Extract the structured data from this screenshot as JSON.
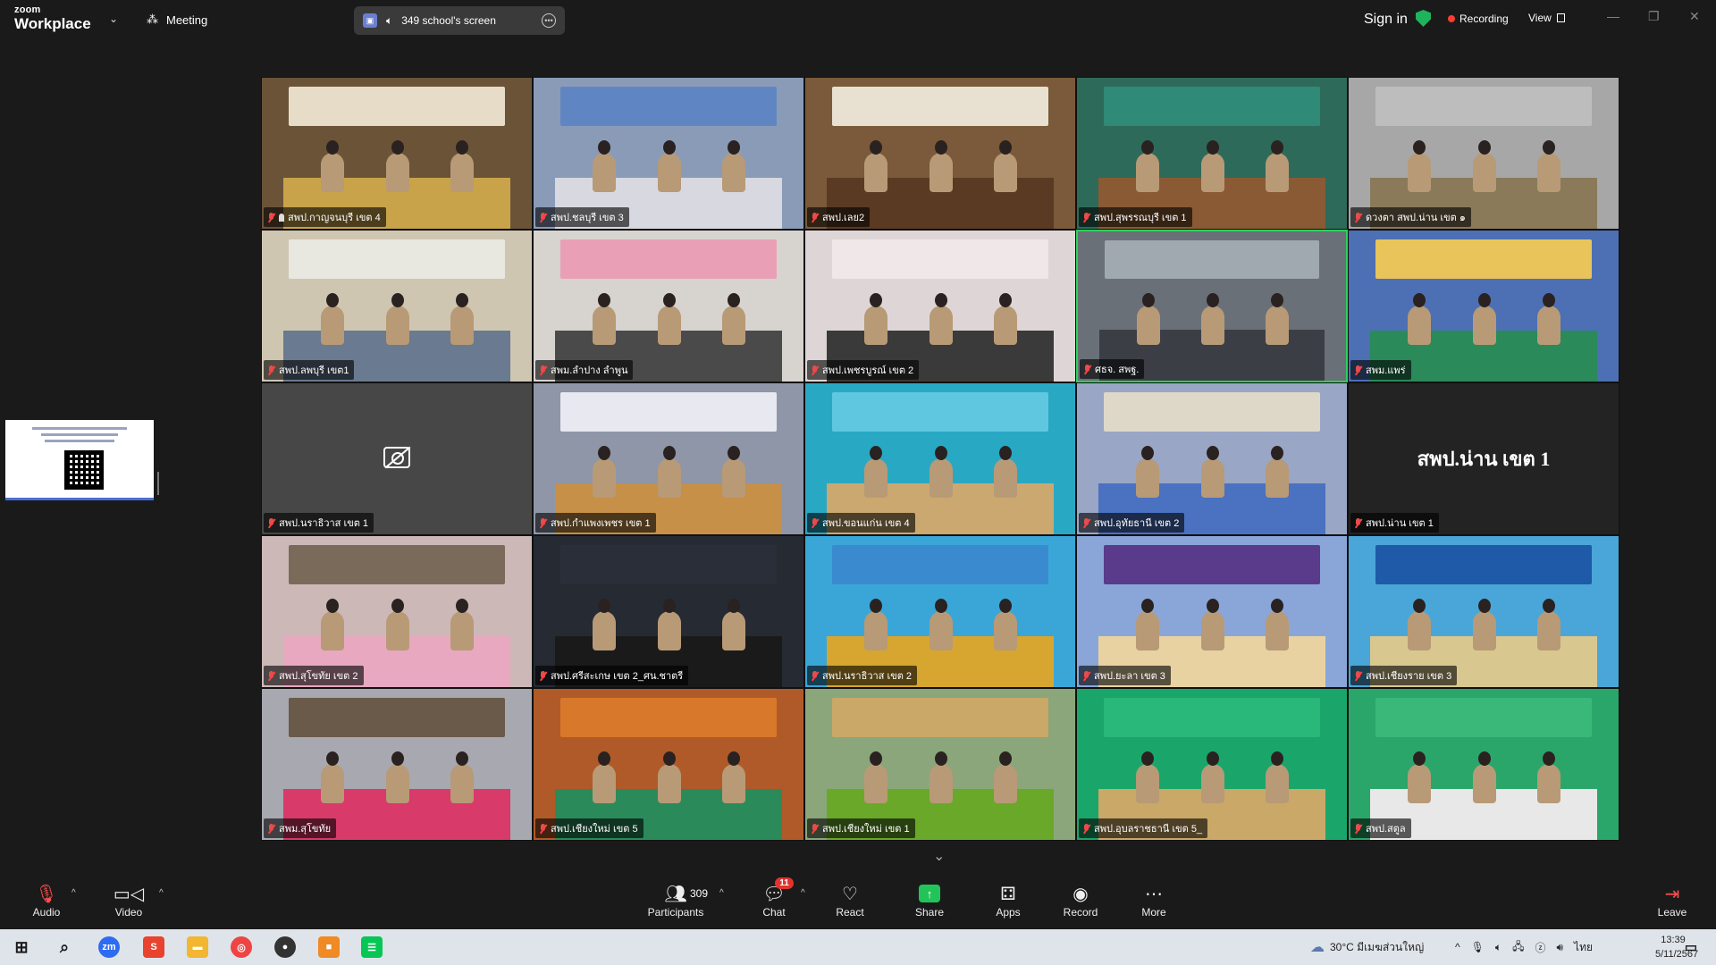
{
  "app": {
    "brand_top": "zoom",
    "brand_bottom": "Workplace",
    "meeting_label": "Meeting",
    "share_pill": "349 school's screen",
    "sign_in": "Sign in",
    "recording": "Recording",
    "view": "View"
  },
  "tiles": [
    {
      "name": "สพป.กาญจนบุรี เขต 4",
      "pinned": true,
      "bg": "#6b5338",
      "accent": "#c9a34a",
      "banner": "#e6dcc8"
    },
    {
      "name": "สพป.ชลบุรี เขต 3",
      "pinned": false,
      "bg": "#8a9bb8",
      "accent": "#d8d8e0",
      "banner": "#5f86c2"
    },
    {
      "name": "สพป.เลย2",
      "pinned": false,
      "bg": "#7a5a3a",
      "accent": "#5a3a22",
      "banner": "#e8e0d0"
    },
    {
      "name": "สพป.สุพรรณบุรี เขต 1",
      "pinned": false,
      "bg": "#2e6a5a",
      "accent": "#8a5a34",
      "banner": "#2f8a78"
    },
    {
      "name": "ดวงตา สพป.น่าน เขต ๑",
      "pinned": false,
      "bg": "#a7a7a7",
      "accent": "#8a7a5a",
      "banner": "#bdbdbd"
    },
    {
      "name": "สพป.ลพบุรี เขต1",
      "pinned": false,
      "bg": "#cfc6b2",
      "accent": "#6a7a90",
      "banner": "#e8e8e0"
    },
    {
      "name": "สพม.ลำปาง ลำพูน",
      "pinned": false,
      "bg": "#d7d3cf",
      "accent": "#4a4a4a",
      "banner": "#e9a0b6"
    },
    {
      "name": "สพป.เพชรบูรณ์ เขต 2",
      "pinned": false,
      "bg": "#ded6d6",
      "accent": "#3a3a3a",
      "banner": "#f0e8e8"
    },
    {
      "name": "ศธจ. สพฐ.",
      "pinned": false,
      "bg": "#6a7078",
      "accent": "#3c3e46",
      "banner": "#a0a8b0",
      "active": true
    },
    {
      "name": "สพม.แพร่",
      "pinned": false,
      "bg": "#4d6fb3",
      "accent": "#2a8a5a",
      "banner": "#e8c45a"
    },
    {
      "name": "สพป.นราธิวาส เขต 1",
      "pinned": false,
      "bg": "#474747",
      "cam_off": true
    },
    {
      "name": "สพป.กำแพงเพชร เขต 1",
      "pinned": false,
      "bg": "#8e96a8",
      "accent": "#c69048",
      "banner": "#e8e8f0"
    },
    {
      "name": "สพป.ขอนแก่น เขต 4",
      "pinned": false,
      "bg": "#29a8c4",
      "accent": "#caa870",
      "banner": "#5fc8e0"
    },
    {
      "name": "สพป.อุทัยธานี เขต 2",
      "pinned": false,
      "bg": "#9aa6c6",
      "accent": "#4a72c0",
      "banner": "#ded8c8"
    },
    {
      "name": "สพป.น่าน เขต 1",
      "pinned": false,
      "bg": "#232323",
      "big_text": "สพป.น่าน เขต 1"
    },
    {
      "name": "สพป.สุโขทัย เขต 2",
      "pinned": false,
      "bg": "#cdb8b8",
      "accent": "#e8a8c0",
      "banner": "#7a6a5a"
    },
    {
      "name": "สพป.ศรีสะเกษ เขต 2_ศน.ชาตรี",
      "pinned": false,
      "bg": "#262a32",
      "accent": "#1a1a1a",
      "banner": "#2a2e38"
    },
    {
      "name": "สพป.นราธิวาส เขต 2",
      "pinned": false,
      "bg": "#3aa6d8",
      "accent": "#d6a630",
      "banner": "#3a8ad0"
    },
    {
      "name": "สพป.ยะลา เขต 3",
      "pinned": false,
      "bg": "#8aa6d8",
      "accent": "#e8d2a2",
      "banner": "#5a3a8a"
    },
    {
      "name": "สพป.เชียงราย เขต 3",
      "pinned": false,
      "bg": "#4aa6d8",
      "accent": "#d8c890",
      "banner": "#1e5aa8"
    },
    {
      "name": "สพม.สุโขทัย",
      "pinned": false,
      "bg": "#a8a8b0",
      "accent": "#d83a6a",
      "banner": "#6a5a4a"
    },
    {
      "name": "สพป.เชียงใหม่ เขต 5",
      "pinned": false,
      "bg": "#b05a2a",
      "accent": "#2a8a5a",
      "banner": "#d8782a"
    },
    {
      "name": "สพป.เชียงใหม่ เขต 1",
      "pinned": false,
      "bg": "#8aa67a",
      "accent": "#6aa82a",
      "banner": "#caa868"
    },
    {
      "name": "สพป.อุบลราชธานี เขต 5_",
      "pinned": false,
      "bg": "#1aa66a",
      "accent": "#caa868",
      "banner": "#2ab87a"
    },
    {
      "name": "สพป.สตูล",
      "pinned": false,
      "bg": "#2aa66a",
      "accent": "#e8e8e8",
      "banner": "#3ab87a"
    }
  ],
  "toolbar": {
    "audio": "Audio",
    "video": "Video",
    "participants": "Participants",
    "participants_count": "309",
    "chat": "Chat",
    "chat_badge": "11",
    "react": "React",
    "share": "Share",
    "apps": "Apps",
    "record": "Record",
    "more": "More",
    "leave": "Leave"
  },
  "taskbar": {
    "weather": "30°C",
    "weather_desc": "มีเมฆส่วนใหญ่",
    "lang": "ไทย",
    "time": "13:39",
    "date": "5/11/2567"
  }
}
